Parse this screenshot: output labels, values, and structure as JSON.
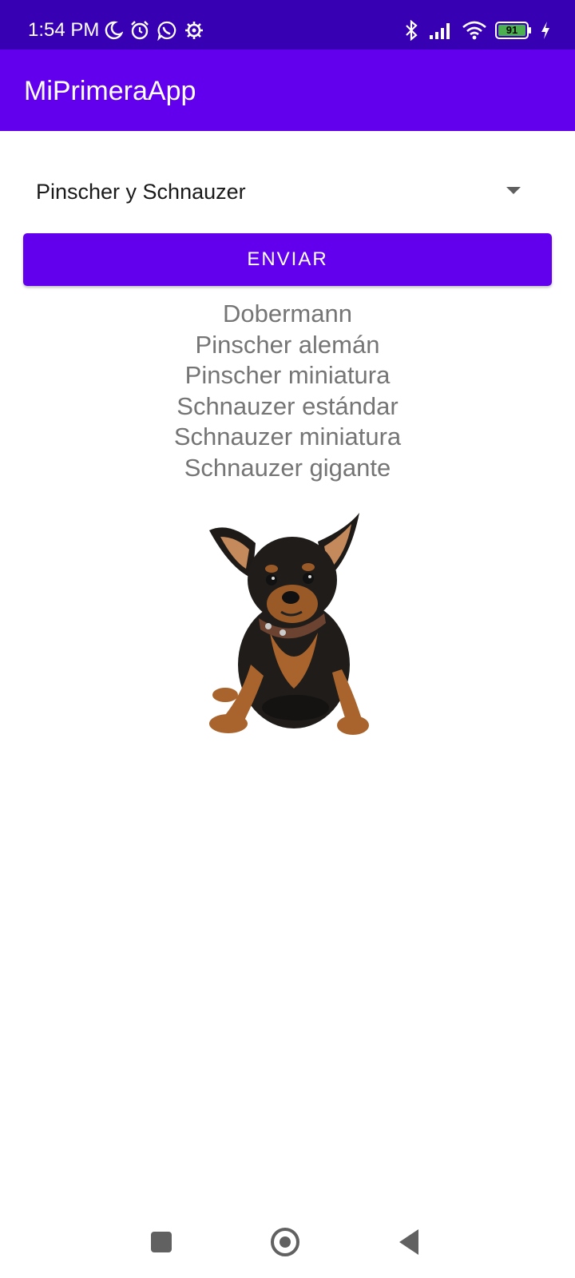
{
  "status_bar": {
    "time": "1:54 PM",
    "left_icons": [
      "moon-icon",
      "alarm-icon",
      "whatsapp-icon",
      "settings-icon"
    ],
    "right_icons": [
      "bluetooth-icon",
      "signal-icon",
      "wifi-icon",
      "battery-icon",
      "charging-icon"
    ],
    "battery_level": "91"
  },
  "app_bar": {
    "title": "MiPrimeraApp"
  },
  "spinner": {
    "selected": "Pinscher y Schnauzer"
  },
  "button": {
    "label": "ENVIAR"
  },
  "breeds": [
    "Dobermann",
    "Pinscher alemán",
    "Pinscher miniatura",
    "Schnauzer estándar",
    "Schnauzer miniatura",
    "Schnauzer gigante"
  ],
  "image": {
    "subject": "miniature pinscher dog"
  },
  "colors": {
    "status_bar": "#3700b3",
    "primary": "#6200ee",
    "breed_text": "#757575"
  }
}
